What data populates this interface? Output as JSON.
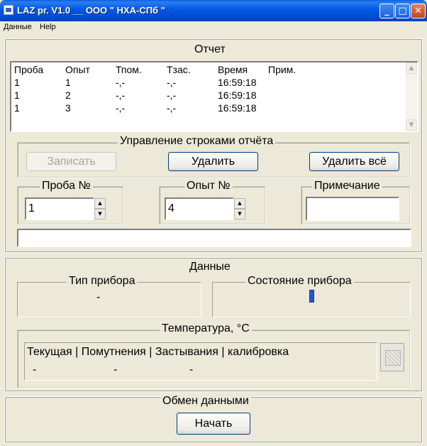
{
  "window": {
    "title": "LAZ pr. V1.0 __ ООО \" НХА-СПб \"",
    "icons": [
      "app-icon",
      "minimize-icon",
      "maximize-icon",
      "close-icon"
    ]
  },
  "menu": [
    "Данные",
    "Help"
  ],
  "report": {
    "title": "Отчет",
    "columns": [
      "Проба",
      "Опыт",
      "Тпом.",
      "Тзас.",
      "Время",
      "Прим."
    ],
    "rows": [
      [
        "1",
        "1",
        "-,-",
        "-,-",
        "16:59:18",
        ""
      ],
      [
        "1",
        "2",
        "-,-",
        "-,-",
        "16:59:18",
        ""
      ],
      [
        "1",
        "3",
        "-,-",
        "-,-",
        "16:59:18",
        ""
      ]
    ],
    "row_controls": {
      "title": "Управление строками отчёта",
      "write_label": "Записать",
      "write_enabled": false,
      "delete_label": "Удалить",
      "delete_all_label": "Удалить всё"
    },
    "sample": {
      "title": "Проба №",
      "value": "1"
    },
    "test": {
      "title": "Опыт №",
      "value": "4"
    },
    "note": {
      "title": "Примечание",
      "value": ""
    },
    "status_line": ""
  },
  "data": {
    "title": "Данные",
    "device_type": {
      "title": "Тип прибора",
      "value": "-"
    },
    "device_state": {
      "title": "Состояние прибора",
      "indicator_color": "#2857c8"
    },
    "temperature": {
      "title": "Температура, °C",
      "headers": "Текущая | Помутнения | Застывания |  калибровка",
      "values": [
        "-",
        "-",
        "-"
      ]
    }
  },
  "exchange": {
    "title": "Обмен данными",
    "start_label": "Начать"
  },
  "colors": {
    "titlebar": "#0058e6",
    "window_bg": "#ece9d8",
    "close_button": "#c84218"
  }
}
